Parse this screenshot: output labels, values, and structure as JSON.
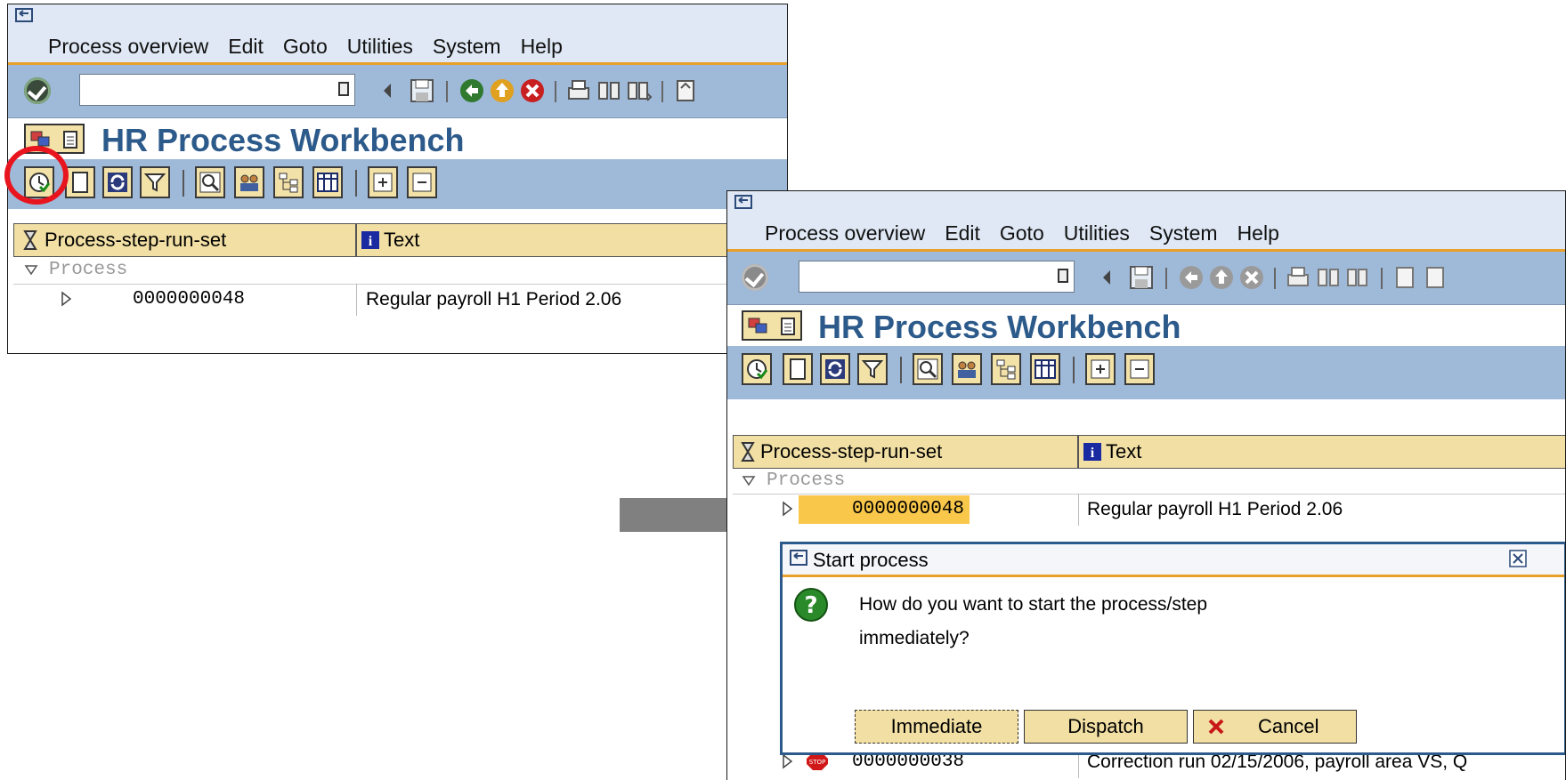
{
  "menu": {
    "process_overview": "Process overview",
    "edit": "Edit",
    "goto": "Goto",
    "utilities": "Utilities",
    "system": "System",
    "help": "Help"
  },
  "command_field": {
    "value": ""
  },
  "title": "HR Process Workbench",
  "grid": {
    "col1_header": "Process-step-run-set",
    "col2_header": "Text",
    "group": "Process",
    "rows": [
      {
        "id": "0000000048",
        "text": "Regular payroll H1 Period 2.06"
      },
      {
        "id": "0000000038",
        "text": "Correction run 02/15/2006, payroll area VS, Q"
      }
    ]
  },
  "dialog": {
    "title": "Start process",
    "line1": "How do you want to start the process/step",
    "line2": "immediately?",
    "btn_immediate": "Immediate",
    "btn_dispatch": "Dispatch",
    "btn_cancel": "Cancel"
  },
  "colors": {
    "menu_bg": "#dfe8f4",
    "toolbar_bg": "#9fb9d8",
    "title_blue": "#2c5a8a",
    "header_beige": "#f1dfa4",
    "highlight": "#f9c74a",
    "annotation_red": "#e8141e",
    "arrow_gray": "#808080"
  }
}
